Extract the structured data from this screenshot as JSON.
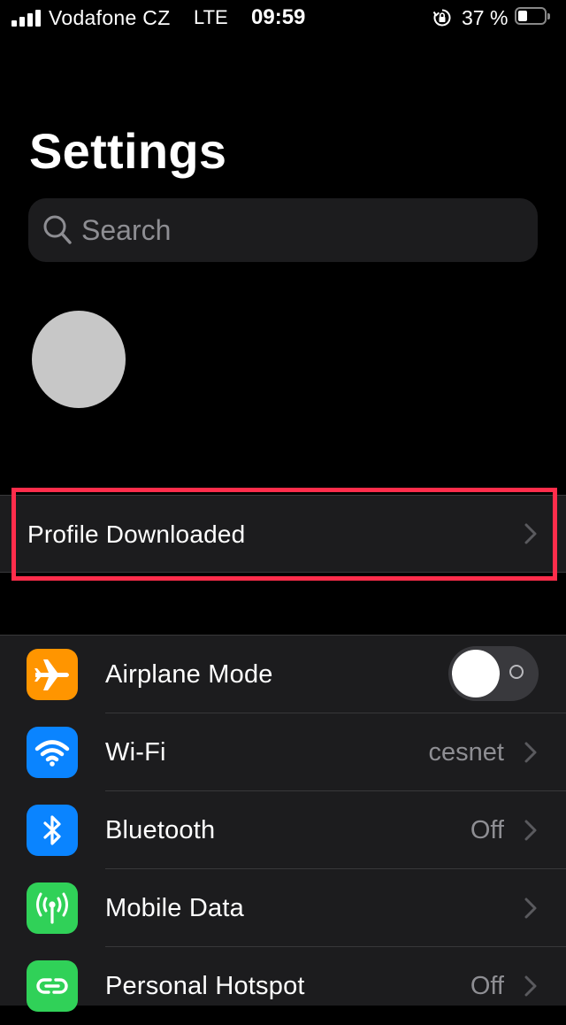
{
  "status_bar": {
    "carrier": "Vodafone CZ",
    "network": "LTE",
    "time": "09:59",
    "battery_percent": "37 %",
    "battery_level": 0.37,
    "signal_bars": 4
  },
  "title": "Settings",
  "search": {
    "placeholder": "Search"
  },
  "profile_banner": {
    "label": "Profile Downloaded",
    "highlight_color": "#ff2d4b"
  },
  "settings": {
    "items": [
      {
        "label": "Airplane Mode",
        "value": "",
        "icon": "airplane-icon",
        "icon_color": "#ff9500",
        "control": "toggle",
        "toggle_on": false
      },
      {
        "label": "Wi-Fi",
        "value": "cesnet",
        "icon": "wifi-icon",
        "icon_color": "#0a84ff",
        "control": "chevron"
      },
      {
        "label": "Bluetooth",
        "value": "Off",
        "icon": "bluetooth-icon",
        "icon_color": "#0a84ff",
        "control": "chevron"
      },
      {
        "label": "Mobile Data",
        "value": "",
        "icon": "antenna-icon",
        "icon_color": "#30d158",
        "control": "chevron"
      },
      {
        "label": "Personal Hotspot",
        "value": "Off",
        "icon": "hotspot-icon",
        "icon_color": "#30d158",
        "control": "chevron"
      }
    ]
  },
  "colors": {
    "background": "#000000",
    "cell_background": "#1c1c1e",
    "secondary_text": "#8e8e93"
  }
}
